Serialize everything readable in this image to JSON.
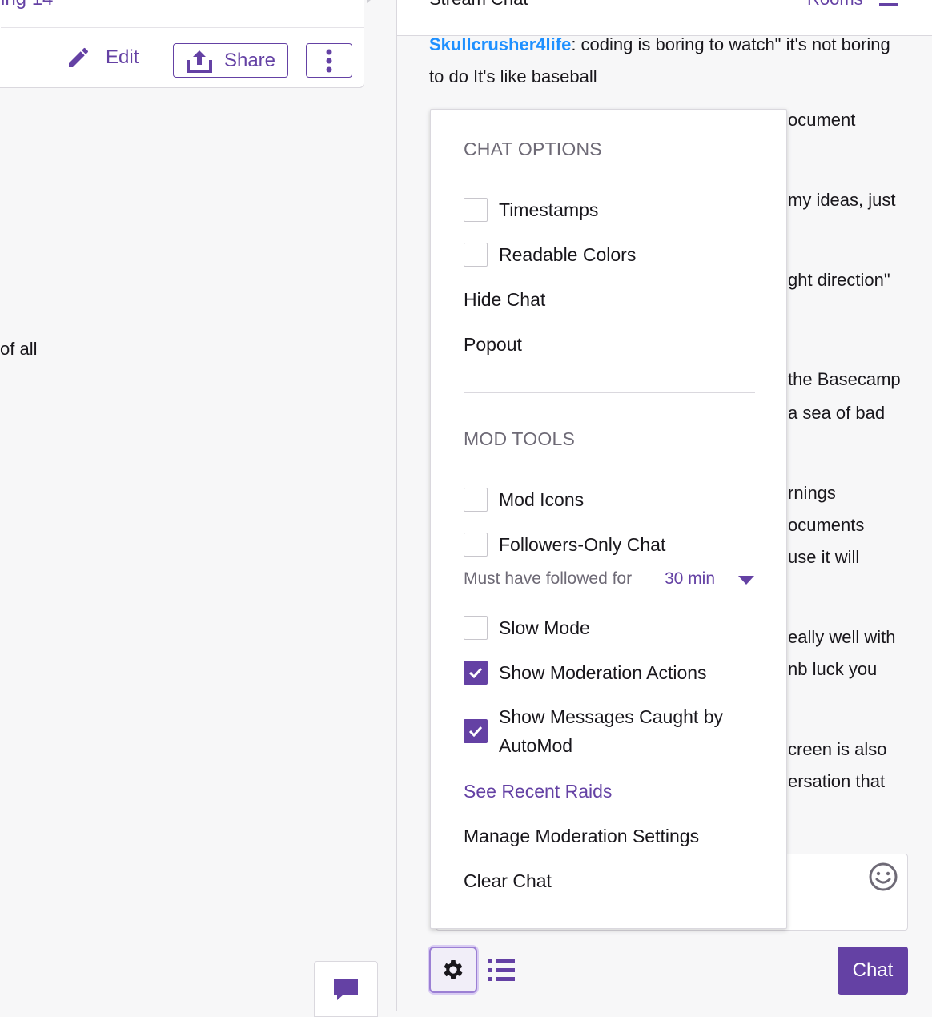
{
  "left": {
    "title_fragment": "ing  14",
    "edit_label": "Edit",
    "share_label": "Share",
    "description_fragment": "of all"
  },
  "chat": {
    "header_title": "Stream Chat",
    "rooms_label": "Rooms",
    "message": {
      "user": "Skullcrusher4life",
      "text": ": coding is boring to watch\" it's not boring to do It's like baseball"
    },
    "fragments": [
      "ocument",
      "my ideas, just",
      "ght direction\"",
      "the Basecamp",
      "a sea of bad",
      "rnings",
      "ocuments",
      "use it will",
      "eally well with",
      "nb luck you",
      "creen is also",
      "ersation that"
    ],
    "send_label": "Chat"
  },
  "menu": {
    "chat_options_title": "CHAT OPTIONS",
    "timestamps": "Timestamps",
    "readable_colors": "Readable Colors",
    "hide_chat": "Hide Chat",
    "popout": "Popout",
    "mod_tools_title": "MOD TOOLS",
    "mod_icons": "Mod Icons",
    "followers_only": "Followers-Only Chat",
    "must_follow_label": "Must have followed for",
    "must_follow_value": "30 min",
    "slow_mode": "Slow Mode",
    "show_mod_actions": "Show Moderation Actions",
    "show_automod_line1": "Show Messages Caught by",
    "show_automod_line2": "AutoMod",
    "see_recent_raids": "See Recent Raids",
    "manage_mod_settings": "Manage Moderation Settings",
    "clear_chat": "Clear Chat"
  },
  "colors": {
    "accent": "#6441a4",
    "username": "#1e90ff"
  }
}
